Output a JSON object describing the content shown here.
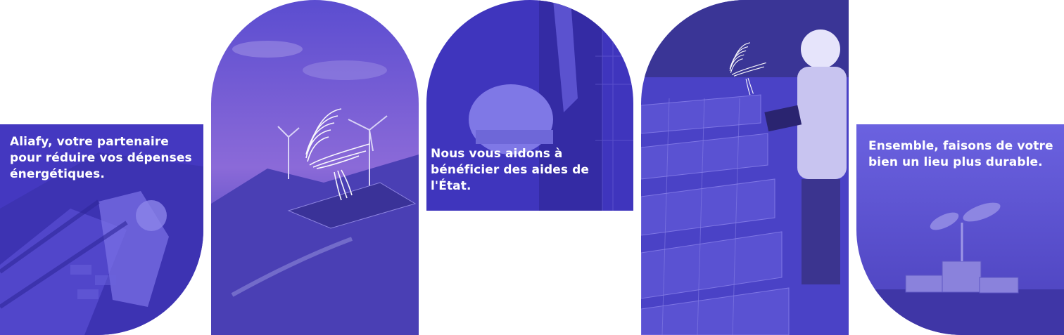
{
  "cards": [
    {
      "id": "c1",
      "caption": "Aliafy, votre partenaire pour réduire vos dépenses énergétiques."
    },
    {
      "id": "c2",
      "caption": ""
    },
    {
      "id": "c3",
      "caption": "Nous vous aidons à bénéficier des aides de l'État."
    },
    {
      "id": "c4",
      "caption": ""
    },
    {
      "id": "c5",
      "caption": "Ensemble, faisons de votre bien un lieu plus durable."
    }
  ],
  "colors": {
    "overlay": "#4a3fc8",
    "overlay_dark": "#3a2fae",
    "overlay_light": "#6a5ee0",
    "text": "#ffffff",
    "background": "#ffffff"
  },
  "icons": [
    "feather-wing-logo"
  ]
}
